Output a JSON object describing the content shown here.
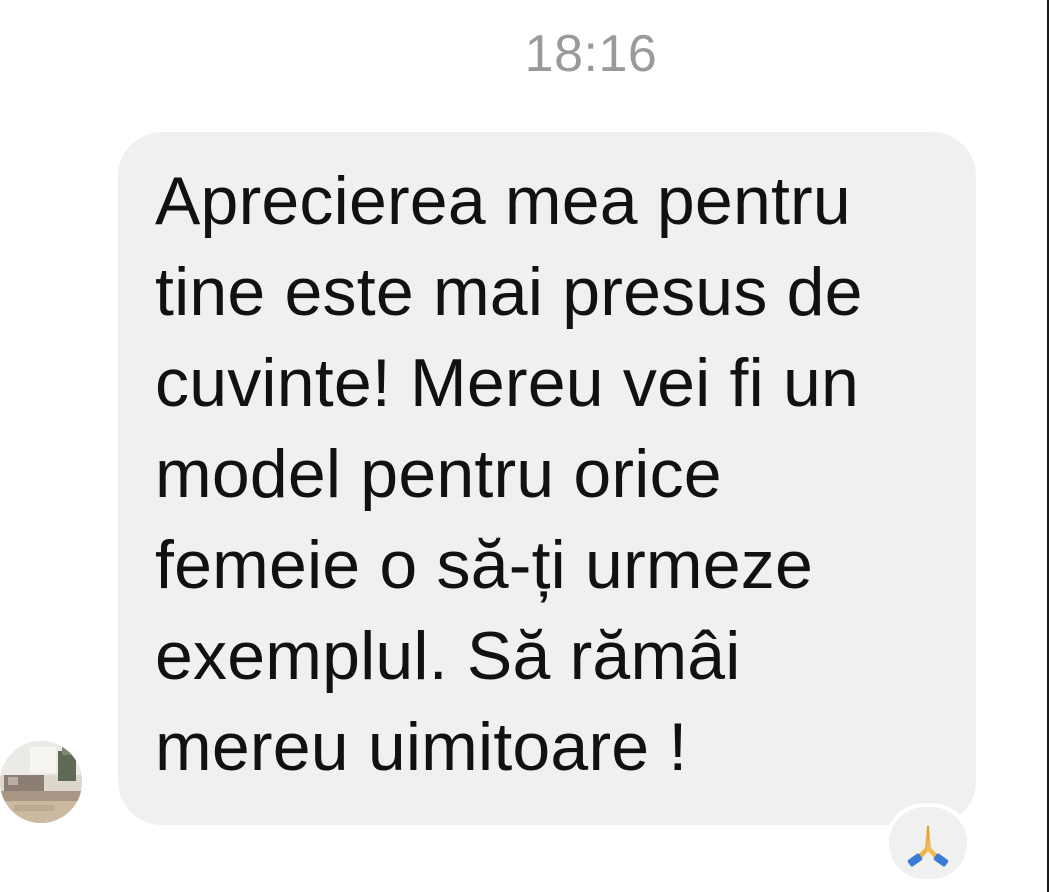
{
  "conversation": {
    "timestamp": "18:16",
    "message": {
      "text": "Aprecierea mea pentru\ntine este mai presus de\ncuvinte! Mereu vei fi un\nmodel pentru orice\nfemeie o să-ți urmeze\nexemplul. Să rămâi\nmereu uimitoare !",
      "bubble_color": "#f0f0f0",
      "text_color": "#111111"
    },
    "reaction": {
      "icon": "folded-hands-icon"
    },
    "avatar": {
      "icon": "contact-avatar"
    }
  }
}
